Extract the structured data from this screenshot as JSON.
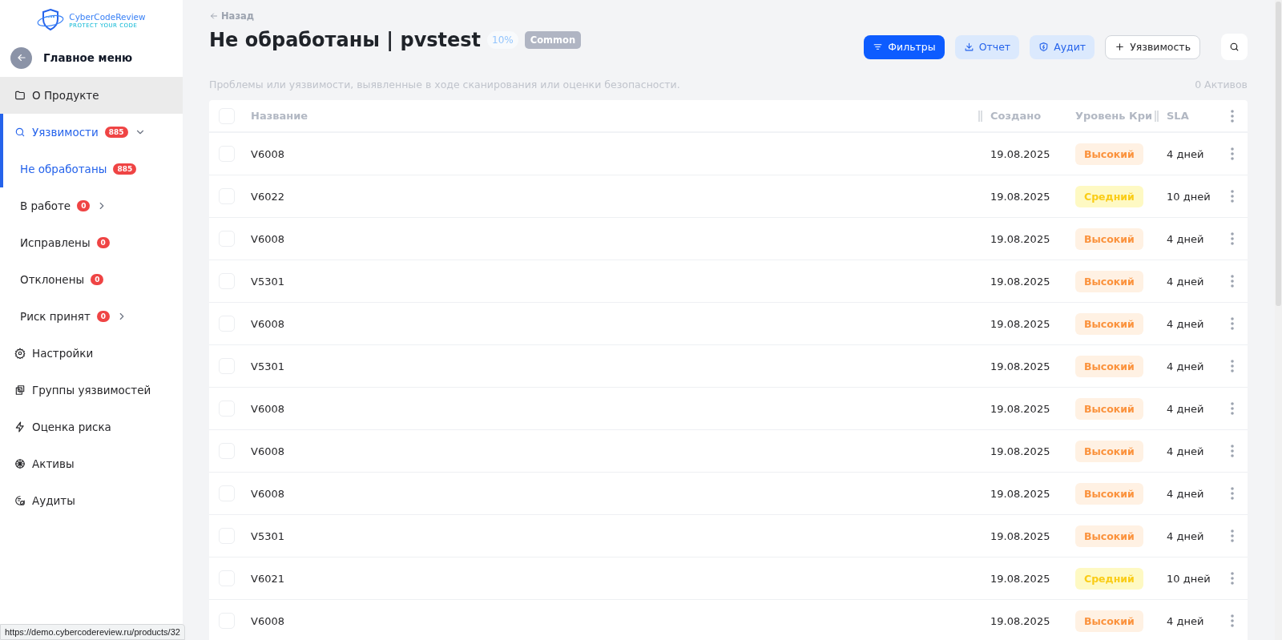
{
  "logo": {
    "name": "CyberCodeReview",
    "tagline": "PROTECT YOUR CODE"
  },
  "sidebar": {
    "back_label": "Главное меню",
    "items": [
      {
        "label": "О Продукте",
        "selected": false,
        "hovered": true
      },
      {
        "label": "Уязвимости",
        "selected": true,
        "hovered": false,
        "badge": "885",
        "expanded": true,
        "children": [
          {
            "label": "Не обработаны",
            "selected": true,
            "badge": "885"
          },
          {
            "label": "В работе",
            "selected": false,
            "badge": "0",
            "expanded": false
          },
          {
            "label": "Исправлены",
            "selected": false,
            "badge": "0"
          },
          {
            "label": "Отклонены",
            "selected": false,
            "badge": "0"
          },
          {
            "label": "Риск принят",
            "selected": false,
            "badge": "0",
            "expanded": false
          }
        ]
      },
      {
        "label": "Настройки",
        "selected": false,
        "hovered": false
      },
      {
        "label": "Группы уязвимостей",
        "selected": false,
        "hovered": false
      },
      {
        "label": "Оценка риска",
        "selected": false,
        "hovered": false
      },
      {
        "label": "Активы",
        "selected": false,
        "hovered": false
      },
      {
        "label": "Аудиты",
        "selected": false,
        "hovered": false
      }
    ]
  },
  "header": {
    "back": "Назад",
    "title": "Не обработаны | pvstest",
    "progress": "10%",
    "tag": "Common",
    "buttons": [
      {
        "label": "Фильтры",
        "kind": "primary"
      },
      {
        "label": "Отчет",
        "kind": "report"
      },
      {
        "label": "Аудит",
        "kind": "audit"
      },
      {
        "label": "Уязвимость",
        "kind": "add"
      }
    ],
    "description": "Проблемы или уязвимости, выявленные в ходе сканирования или оценки безопасности.",
    "assets_count": "0 Активов"
  },
  "table": {
    "columns": [
      "Название",
      "Создано",
      "Уровень Кри",
      "SLA"
    ],
    "header_checked": false,
    "rows": [
      {
        "checked": false,
        "name": "V6008",
        "created": "19.08.2025",
        "level": {
          "text": "Высокий",
          "kind": "high"
        },
        "sla": "4 дней"
      },
      {
        "checked": false,
        "name": "V6022",
        "created": "19.08.2025",
        "level": {
          "text": "Средний",
          "kind": "medium"
        },
        "sla": "10 дней"
      },
      {
        "checked": false,
        "name": "V6008",
        "created": "19.08.2025",
        "level": {
          "text": "Высокий",
          "kind": "high"
        },
        "sla": "4 дней"
      },
      {
        "checked": false,
        "name": "V5301",
        "created": "19.08.2025",
        "level": {
          "text": "Высокий",
          "kind": "high"
        },
        "sla": "4 дней"
      },
      {
        "checked": false,
        "name": "V6008",
        "created": "19.08.2025",
        "level": {
          "text": "Высокий",
          "kind": "high"
        },
        "sla": "4 дней"
      },
      {
        "checked": false,
        "name": "V5301",
        "created": "19.08.2025",
        "level": {
          "text": "Высокий",
          "kind": "high"
        },
        "sla": "4 дней"
      },
      {
        "checked": false,
        "name": "V6008",
        "created": "19.08.2025",
        "level": {
          "text": "Высокий",
          "kind": "high"
        },
        "sla": "4 дней"
      },
      {
        "checked": false,
        "name": "V6008",
        "created": "19.08.2025",
        "level": {
          "text": "Высокий",
          "kind": "high"
        },
        "sla": "4 дней"
      },
      {
        "checked": false,
        "name": "V6008",
        "created": "19.08.2025",
        "level": {
          "text": "Высокий",
          "kind": "high"
        },
        "sla": "4 дней"
      },
      {
        "checked": false,
        "name": "V5301",
        "created": "19.08.2025",
        "level": {
          "text": "Высокий",
          "kind": "high"
        },
        "sla": "4 дней"
      },
      {
        "checked": false,
        "name": "V6021",
        "created": "19.08.2025",
        "level": {
          "text": "Средний",
          "kind": "medium"
        },
        "sla": "10 дней"
      },
      {
        "checked": false,
        "name": "V6008",
        "created": "19.08.2025",
        "level": {
          "text": "Высокий",
          "kind": "high"
        },
        "sla": "4 дней"
      }
    ]
  },
  "status_bar": {
    "url": "https://demo.cybercodereview.ru/products/32"
  }
}
